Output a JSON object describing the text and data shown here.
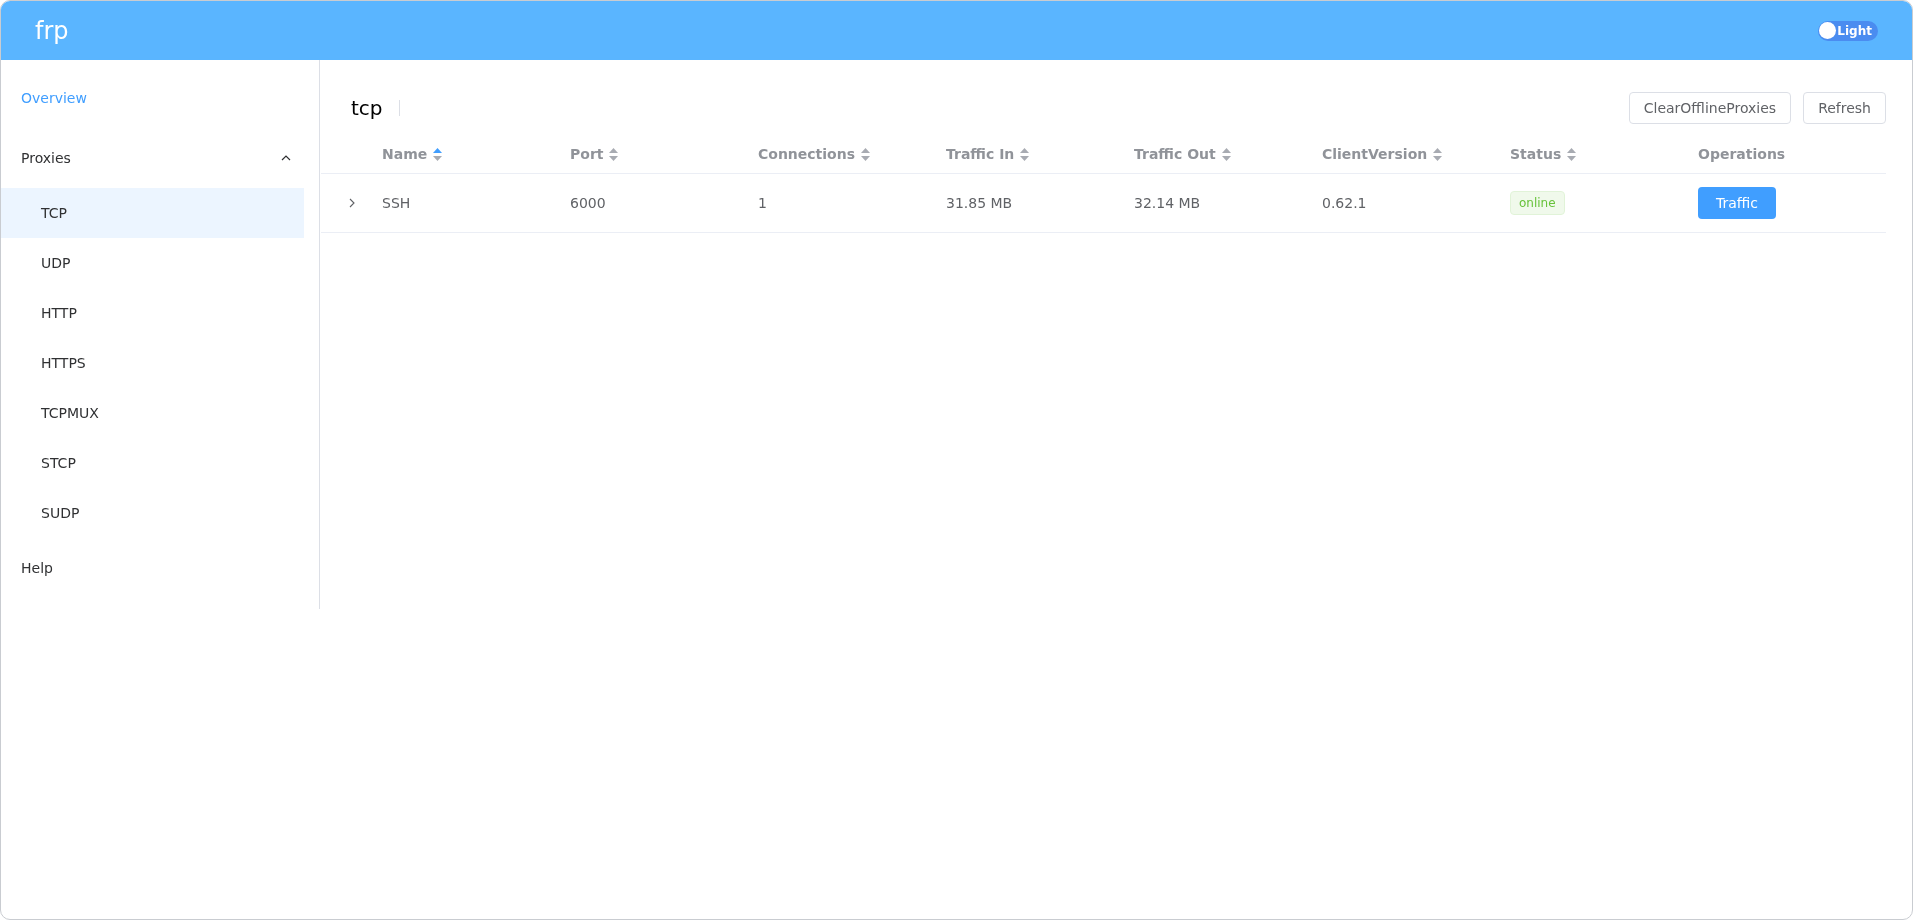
{
  "header": {
    "logo": "frp",
    "theme_switch": {
      "label": "Light",
      "on": false
    }
  },
  "sidebar": {
    "items": [
      {
        "label": "Overview",
        "selected": true
      },
      {
        "label": "Proxies",
        "selected": false,
        "expanded": true,
        "children": [
          {
            "label": "TCP",
            "selected": true
          },
          {
            "label": "UDP",
            "selected": false
          },
          {
            "label": "HTTP",
            "selected": false
          },
          {
            "label": "HTTPS",
            "selected": false
          },
          {
            "label": "TCPMUX",
            "selected": false
          },
          {
            "label": "STCP",
            "selected": false
          },
          {
            "label": "SUDP",
            "selected": false
          }
        ]
      },
      {
        "label": "Help",
        "selected": false
      }
    ]
  },
  "page": {
    "title": "tcp",
    "buttons": [
      "ClearOfflineProxies",
      "Refresh"
    ]
  },
  "table": {
    "columns": [
      {
        "label": "Name",
        "sorted": true
      },
      {
        "label": "Port",
        "sorted": false
      },
      {
        "label": "Connections",
        "sorted": false
      },
      {
        "label": "Traffic In",
        "sorted": false
      },
      {
        "label": "Traffic Out",
        "sorted": false
      },
      {
        "label": "ClientVersion",
        "sorted": false
      },
      {
        "label": "Status",
        "sorted": false
      },
      {
        "label": "Operations"
      }
    ],
    "rows": [
      {
        "expanded": false,
        "cells": [
          "SSH",
          "6000",
          "1",
          "31.85 MB",
          "32.14 MB",
          "0.62.1"
        ],
        "status": "online",
        "status_ok": true,
        "action": "Traffic"
      }
    ]
  }
}
